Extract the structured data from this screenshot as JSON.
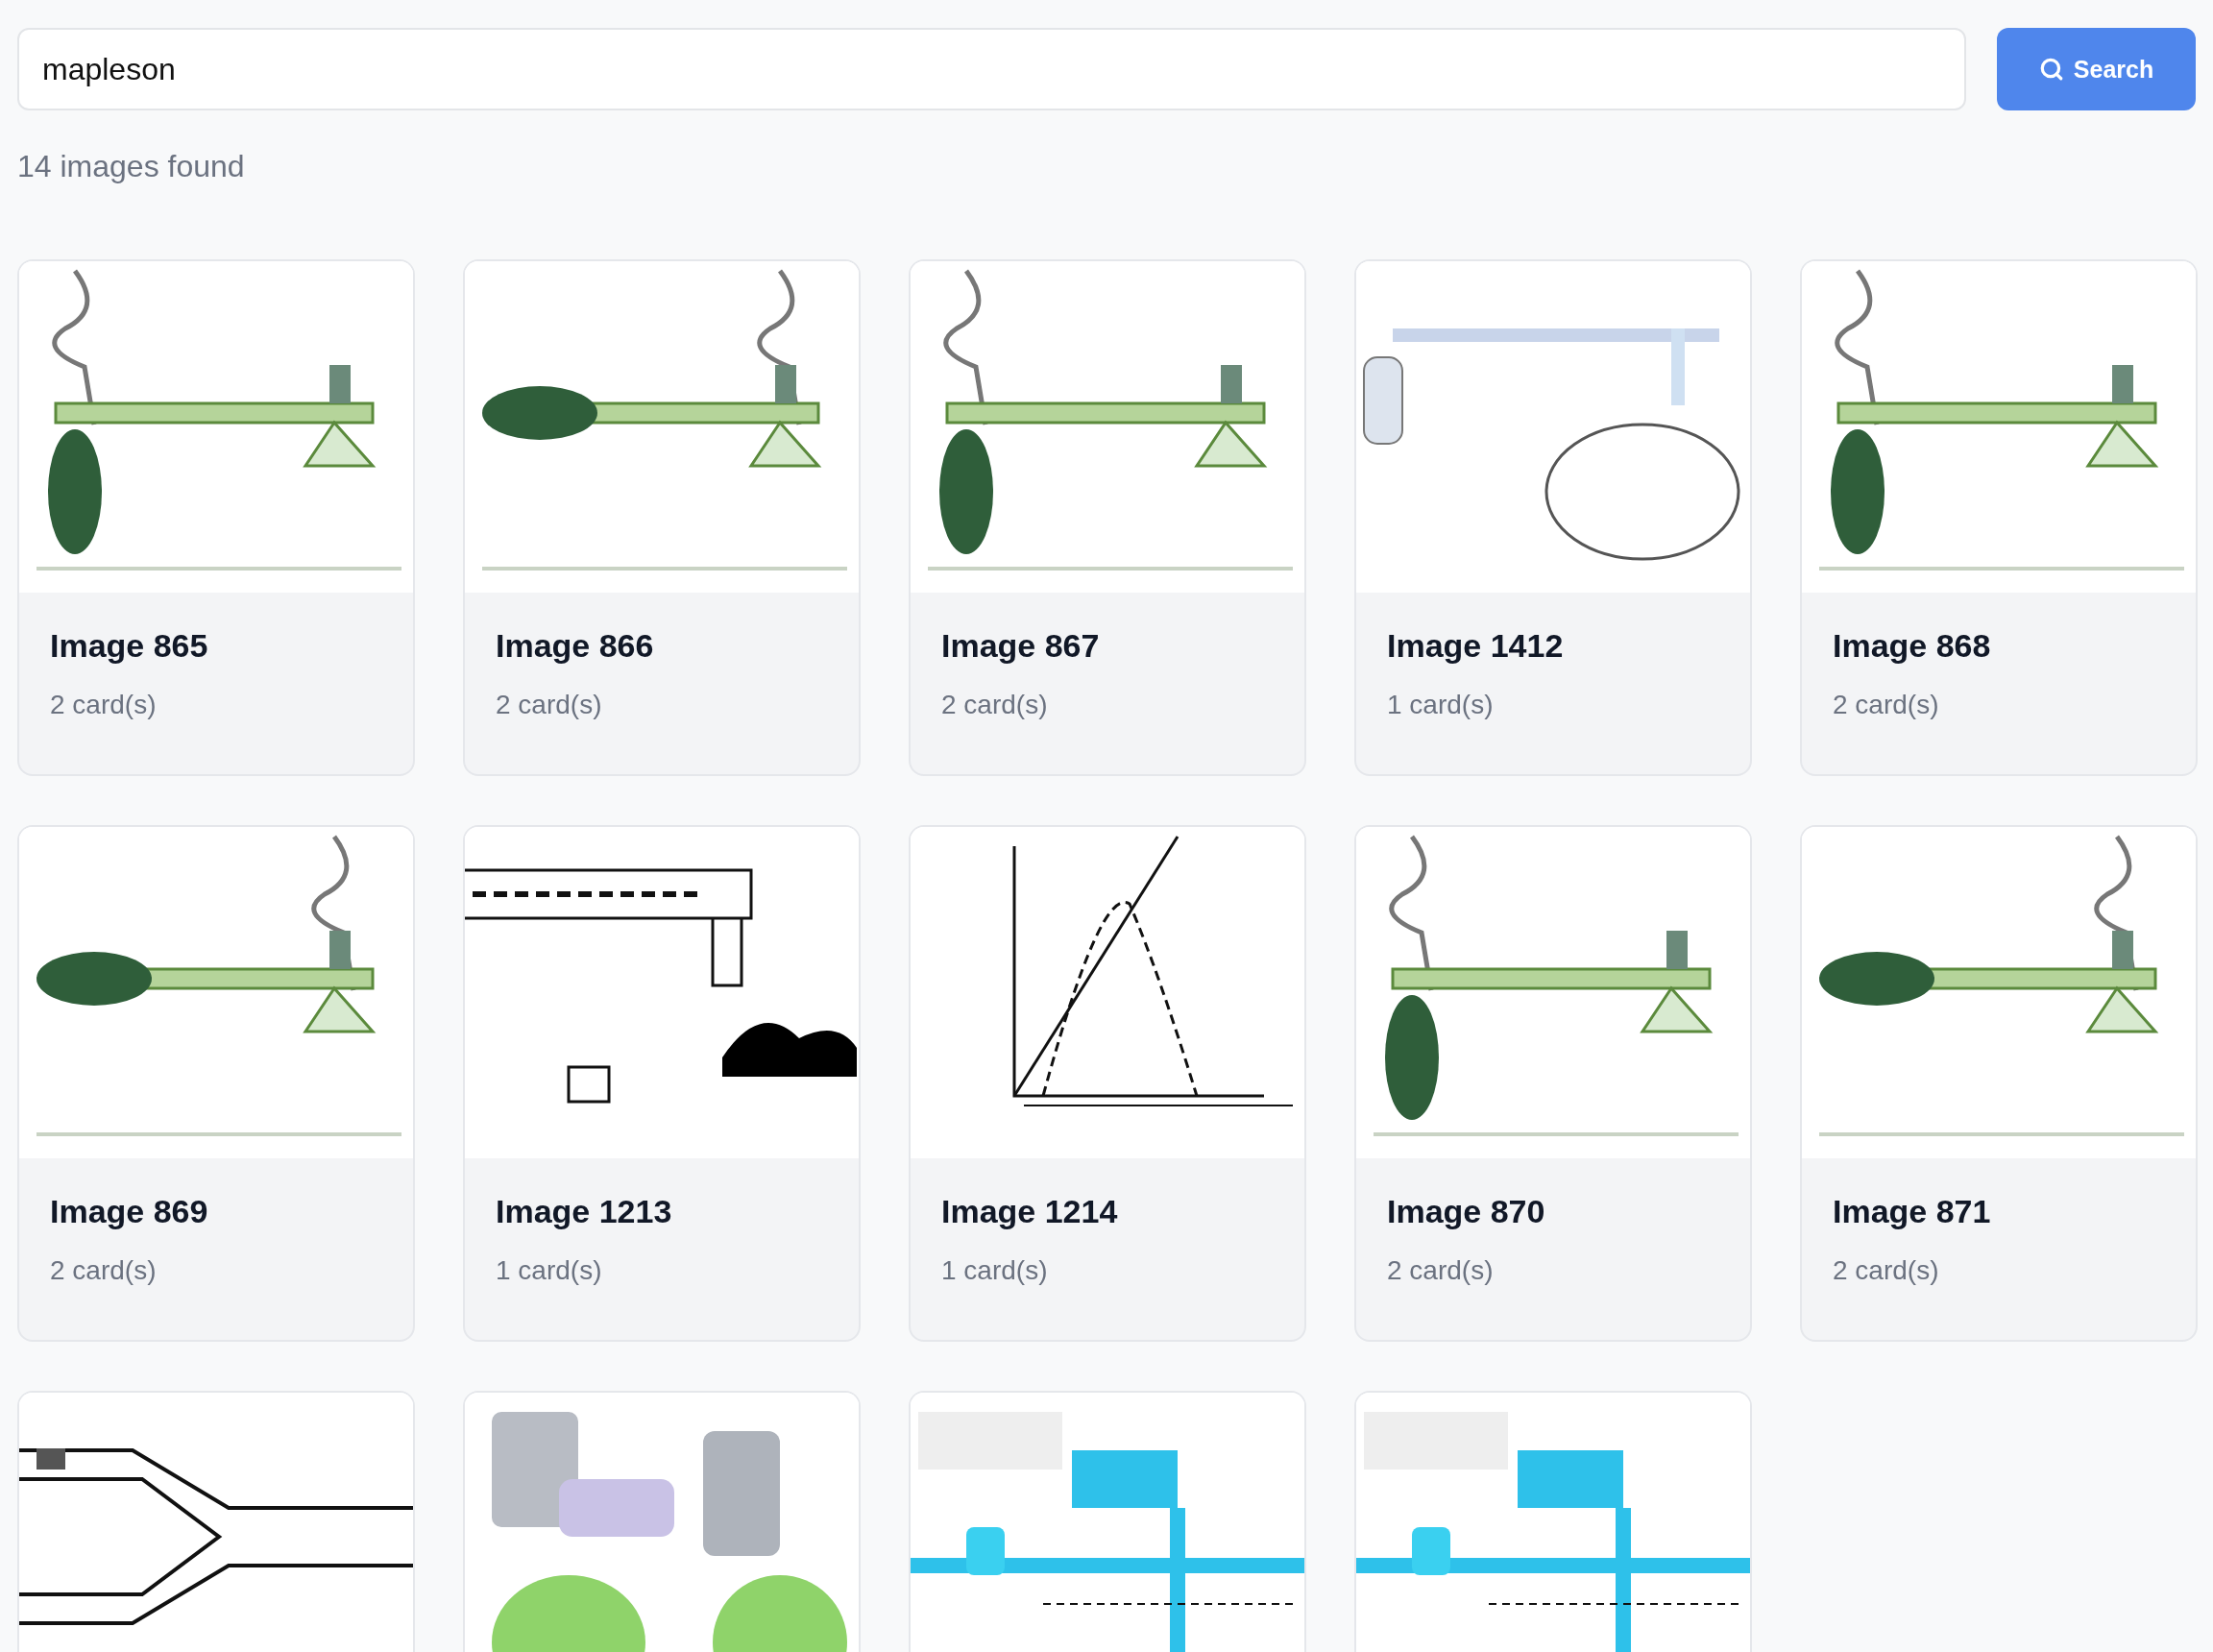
{
  "search": {
    "value": "mapleson",
    "button": "Search"
  },
  "result_count": "14 images found",
  "results": [
    {
      "kind": "picture",
      "title": "Image 865",
      "count": "2 card(s)"
    },
    {
      "kind": "picture",
      "title": "Image 866",
      "count": "2 card(s)"
    },
    {
      "kind": "picture",
      "title": "Image 867",
      "count": "2 card(s)"
    },
    {
      "kind": "picture",
      "title": "Image 1412",
      "count": "1 card(s)"
    },
    {
      "kind": "picture",
      "title": "Image 868",
      "count": "2 card(s)"
    },
    {
      "kind": "picture",
      "title": "Image 869",
      "count": "2 card(s)"
    },
    {
      "kind": "picture",
      "title": "Image 1213",
      "count": "1 card(s)"
    },
    {
      "kind": "picture",
      "title": "Image 1214",
      "count": "1 card(s)"
    },
    {
      "kind": "picture",
      "title": "Image 870",
      "count": "2 card(s)"
    },
    {
      "kind": "picture",
      "title": "Image 871",
      "count": "2 card(s)"
    },
    {
      "kind": "picture"
    },
    {
      "kind": "picture"
    },
    {
      "kind": "picture"
    },
    {
      "kind": "picture"
    }
  ]
}
